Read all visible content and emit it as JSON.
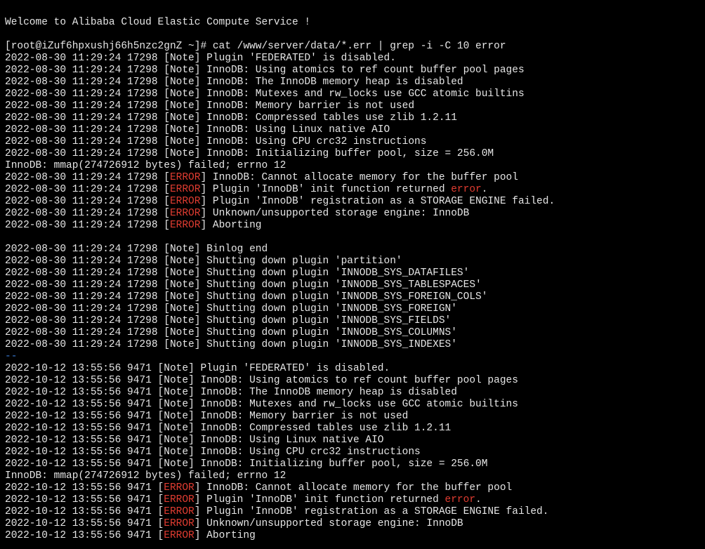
{
  "colors": {
    "background": "#000000",
    "text": "#e6e6e6",
    "error": "#e03c31",
    "separator": "#3a7bd5"
  },
  "lines": [
    {
      "type": "text",
      "text": "Welcome to Alibaba Cloud Elastic Compute Service !"
    },
    {
      "type": "blank"
    },
    {
      "type": "text",
      "text": "[root@iZuf6hpxushj66h5nzc2gnZ ~]# cat /www/server/data/*.err | grep -i -C 10 error"
    },
    {
      "type": "note",
      "prefix": "2022-08-30 11:29:24 17298 [",
      "tag": "Note",
      "suffix": "] Plugin 'FEDERATED' is disabled."
    },
    {
      "type": "note",
      "prefix": "2022-08-30 11:29:24 17298 [",
      "tag": "Note",
      "suffix": "] InnoDB: Using atomics to ref count buffer pool pages"
    },
    {
      "type": "note",
      "prefix": "2022-08-30 11:29:24 17298 [",
      "tag": "Note",
      "suffix": "] InnoDB: The InnoDB memory heap is disabled"
    },
    {
      "type": "note",
      "prefix": "2022-08-30 11:29:24 17298 [",
      "tag": "Note",
      "suffix": "] InnoDB: Mutexes and rw_locks use GCC atomic builtins"
    },
    {
      "type": "note",
      "prefix": "2022-08-30 11:29:24 17298 [",
      "tag": "Note",
      "suffix": "] InnoDB: Memory barrier is not used"
    },
    {
      "type": "note",
      "prefix": "2022-08-30 11:29:24 17298 [",
      "tag": "Note",
      "suffix": "] InnoDB: Compressed tables use zlib 1.2.11"
    },
    {
      "type": "note",
      "prefix": "2022-08-30 11:29:24 17298 [",
      "tag": "Note",
      "suffix": "] InnoDB: Using Linux native AIO"
    },
    {
      "type": "note",
      "prefix": "2022-08-30 11:29:24 17298 [",
      "tag": "Note",
      "suffix": "] InnoDB: Using CPU crc32 instructions"
    },
    {
      "type": "note",
      "prefix": "2022-08-30 11:29:24 17298 [",
      "tag": "Note",
      "suffix": "] InnoDB: Initializing buffer pool, size = 256.0M"
    },
    {
      "type": "text",
      "text": "InnoDB: mmap(274726912 bytes) failed; errno 12"
    },
    {
      "type": "error",
      "prefix": "2022-08-30 11:29:24 17298 [",
      "tag": "ERROR",
      "suffix": "] InnoDB: Cannot allocate memory for the buffer pool"
    },
    {
      "type": "error",
      "prefix": "2022-08-30 11:29:24 17298 [",
      "tag": "ERROR",
      "suffix": "] Plugin 'InnoDB' init function returned ",
      "highlight": "error",
      "tail": "."
    },
    {
      "type": "error",
      "prefix": "2022-08-30 11:29:24 17298 [",
      "tag": "ERROR",
      "suffix": "] Plugin 'InnoDB' registration as a STORAGE ENGINE failed."
    },
    {
      "type": "error",
      "prefix": "2022-08-30 11:29:24 17298 [",
      "tag": "ERROR",
      "suffix": "] Unknown/unsupported storage engine: InnoDB"
    },
    {
      "type": "error",
      "prefix": "2022-08-30 11:29:24 17298 [",
      "tag": "ERROR",
      "suffix": "] Aborting"
    },
    {
      "type": "blank"
    },
    {
      "type": "note",
      "prefix": "2022-08-30 11:29:24 17298 [",
      "tag": "Note",
      "suffix": "] Binlog end"
    },
    {
      "type": "note",
      "prefix": "2022-08-30 11:29:24 17298 [",
      "tag": "Note",
      "suffix": "] Shutting down plugin 'partition'"
    },
    {
      "type": "note",
      "prefix": "2022-08-30 11:29:24 17298 [",
      "tag": "Note",
      "suffix": "] Shutting down plugin 'INNODB_SYS_DATAFILES'"
    },
    {
      "type": "note",
      "prefix": "2022-08-30 11:29:24 17298 [",
      "tag": "Note",
      "suffix": "] Shutting down plugin 'INNODB_SYS_TABLESPACES'"
    },
    {
      "type": "note",
      "prefix": "2022-08-30 11:29:24 17298 [",
      "tag": "Note",
      "suffix": "] Shutting down plugin 'INNODB_SYS_FOREIGN_COLS'"
    },
    {
      "type": "note",
      "prefix": "2022-08-30 11:29:24 17298 [",
      "tag": "Note",
      "suffix": "] Shutting down plugin 'INNODB_SYS_FOREIGN'"
    },
    {
      "type": "note",
      "prefix": "2022-08-30 11:29:24 17298 [",
      "tag": "Note",
      "suffix": "] Shutting down plugin 'INNODB_SYS_FIELDS'"
    },
    {
      "type": "note",
      "prefix": "2022-08-30 11:29:24 17298 [",
      "tag": "Note",
      "suffix": "] Shutting down plugin 'INNODB_SYS_COLUMNS'"
    },
    {
      "type": "note",
      "prefix": "2022-08-30 11:29:24 17298 [",
      "tag": "Note",
      "suffix": "] Shutting down plugin 'INNODB_SYS_INDEXES'"
    },
    {
      "type": "separator",
      "text": "--"
    },
    {
      "type": "note",
      "prefix": "2022-10-12 13:55:56 9471 [",
      "tag": "Note",
      "suffix": "] Plugin 'FEDERATED' is disabled."
    },
    {
      "type": "note",
      "prefix": "2022-10-12 13:55:56 9471 [",
      "tag": "Note",
      "suffix": "] InnoDB: Using atomics to ref count buffer pool pages"
    },
    {
      "type": "note",
      "prefix": "2022-10-12 13:55:56 9471 [",
      "tag": "Note",
      "suffix": "] InnoDB: The InnoDB memory heap is disabled"
    },
    {
      "type": "note",
      "prefix": "2022-10-12 13:55:56 9471 [",
      "tag": "Note",
      "suffix": "] InnoDB: Mutexes and rw_locks use GCC atomic builtins"
    },
    {
      "type": "note",
      "prefix": "2022-10-12 13:55:56 9471 [",
      "tag": "Note",
      "suffix": "] InnoDB: Memory barrier is not used"
    },
    {
      "type": "note",
      "prefix": "2022-10-12 13:55:56 9471 [",
      "tag": "Note",
      "suffix": "] InnoDB: Compressed tables use zlib 1.2.11"
    },
    {
      "type": "note",
      "prefix": "2022-10-12 13:55:56 9471 [",
      "tag": "Note",
      "suffix": "] InnoDB: Using Linux native AIO"
    },
    {
      "type": "note",
      "prefix": "2022-10-12 13:55:56 9471 [",
      "tag": "Note",
      "suffix": "] InnoDB: Using CPU crc32 instructions"
    },
    {
      "type": "note",
      "prefix": "2022-10-12 13:55:56 9471 [",
      "tag": "Note",
      "suffix": "] InnoDB: Initializing buffer pool, size = 256.0M"
    },
    {
      "type": "text",
      "text": "InnoDB: mmap(274726912 bytes) failed; errno 12"
    },
    {
      "type": "error",
      "prefix": "2022-10-12 13:55:56 9471 [",
      "tag": "ERROR",
      "suffix": "] InnoDB: Cannot allocate memory for the buffer pool"
    },
    {
      "type": "error",
      "prefix": "2022-10-12 13:55:56 9471 [",
      "tag": "ERROR",
      "suffix": "] Plugin 'InnoDB' init function returned ",
      "highlight": "error",
      "tail": "."
    },
    {
      "type": "error",
      "prefix": "2022-10-12 13:55:56 9471 [",
      "tag": "ERROR",
      "suffix": "] Plugin 'InnoDB' registration as a STORAGE ENGINE failed."
    },
    {
      "type": "error",
      "prefix": "2022-10-12 13:55:56 9471 [",
      "tag": "ERROR",
      "suffix": "] Unknown/unsupported storage engine: InnoDB"
    },
    {
      "type": "error",
      "prefix": "2022-10-12 13:55:56 9471 [",
      "tag": "ERROR",
      "suffix": "] Aborting"
    }
  ]
}
